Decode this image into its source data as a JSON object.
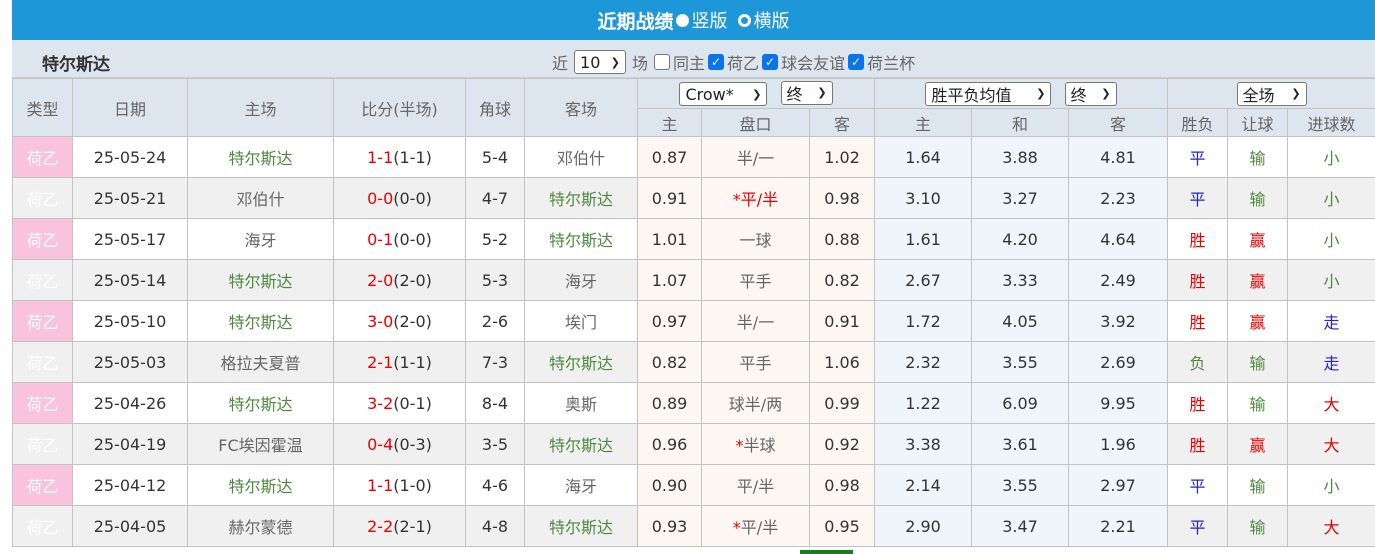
{
  "header": {
    "title": "近期战绩",
    "view_vertical": "竖版",
    "view_horizontal": "横版"
  },
  "filter": {
    "team": "特尔斯达",
    "recent_prefix": "近",
    "count": "10",
    "recent_suffix": "场",
    "same_home": "同主",
    "same_home_checked": false,
    "league": "荷乙",
    "league_checked": true,
    "friendly": "球会友谊",
    "friendly_checked": true,
    "cup": "荷兰杯",
    "cup_checked": true
  },
  "columns": {
    "type": "类型",
    "date": "日期",
    "home": "主场",
    "score": "比分(半场)",
    "corner": "角球",
    "away": "客场",
    "ah_home": "主",
    "ah_line": "盘口",
    "ah_away": "客",
    "eu_home": "主",
    "eu_draw": "和",
    "eu_away": "客",
    "res": "胜负",
    "hcp": "让球",
    "goals": "进球数"
  },
  "selects": {
    "company": "Crow*",
    "ah_time": "终",
    "eu_type": "胜平负均值",
    "eu_time": "终",
    "period": "全场"
  },
  "colors": {
    "header": "#1e97d8",
    "team_highlight": "#4d8a3e",
    "win": "#ee0000",
    "draw": "#2222dd",
    "lose": "#4d8a3e",
    "type_bg": "#f9c3de"
  },
  "rows": [
    {
      "type": "荷乙",
      "date": "25-05-24",
      "home": "特尔斯达",
      "score": "1-1",
      "half": "(1-1)",
      "corner": "5-4",
      "away": "邓伯什",
      "ah_h": "0.87",
      "star": "",
      "line": "半/一",
      "line_red": false,
      "ah_a": "1.02",
      "eu_h": "1.64",
      "eu_d": "3.88",
      "eu_a": "4.81",
      "res": "平",
      "hcp": "输",
      "goals": "小"
    },
    {
      "type": "荷乙",
      "date": "25-05-21",
      "home": "邓伯什",
      "score": "0-0",
      "half": "(0-0)",
      "corner": "4-7",
      "away": "特尔斯达",
      "ah_h": "0.91",
      "star": "*",
      "line": "平/半",
      "line_red": true,
      "ah_a": "0.98",
      "eu_h": "3.10",
      "eu_d": "3.27",
      "eu_a": "2.23",
      "res": "平",
      "hcp": "输",
      "goals": "小"
    },
    {
      "type": "荷乙",
      "date": "25-05-17",
      "home": "海牙",
      "score": "0-1",
      "half": "(0-0)",
      "corner": "5-2",
      "away": "特尔斯达",
      "ah_h": "1.01",
      "star": "",
      "line": "一球",
      "line_red": false,
      "ah_a": "0.88",
      "eu_h": "1.61",
      "eu_d": "4.20",
      "eu_a": "4.64",
      "res": "胜",
      "hcp": "赢",
      "goals": "小"
    },
    {
      "type": "荷乙",
      "date": "25-05-14",
      "home": "特尔斯达",
      "score": "2-0",
      "half": "(2-0)",
      "corner": "5-3",
      "away": "海牙",
      "ah_h": "1.07",
      "star": "",
      "line": "平手",
      "line_red": false,
      "ah_a": "0.82",
      "eu_h": "2.67",
      "eu_d": "3.33",
      "eu_a": "2.49",
      "res": "胜",
      "hcp": "赢",
      "goals": "小"
    },
    {
      "type": "荷乙",
      "date": "25-05-10",
      "home": "特尔斯达",
      "score": "3-0",
      "half": "(2-0)",
      "corner": "2-6",
      "away": "埃门",
      "ah_h": "0.97",
      "star": "",
      "line": "半/一",
      "line_red": false,
      "ah_a": "0.91",
      "eu_h": "1.72",
      "eu_d": "4.05",
      "eu_a": "3.92",
      "res": "胜",
      "hcp": "赢",
      "goals": "走"
    },
    {
      "type": "荷乙",
      "date": "25-05-03",
      "home": "格拉夫夏普",
      "score": "2-1",
      "half": "(1-1)",
      "corner": "7-3",
      "away": "特尔斯达",
      "ah_h": "0.82",
      "star": "",
      "line": "平手",
      "line_red": false,
      "ah_a": "1.06",
      "eu_h": "2.32",
      "eu_d": "3.55",
      "eu_a": "2.69",
      "res": "负",
      "hcp": "输",
      "goals": "走"
    },
    {
      "type": "荷乙",
      "date": "25-04-26",
      "home": "特尔斯达",
      "score": "3-2",
      "half": "(0-1)",
      "corner": "8-4",
      "away": "奥斯",
      "ah_h": "0.89",
      "star": "",
      "line": "球半/两",
      "line_red": false,
      "ah_a": "0.99",
      "eu_h": "1.22",
      "eu_d": "6.09",
      "eu_a": "9.95",
      "res": "胜",
      "hcp": "输",
      "goals": "大"
    },
    {
      "type": "荷乙",
      "date": "25-04-19",
      "home": "FC埃因霍温",
      "score": "0-4",
      "half": "(0-3)",
      "corner": "3-5",
      "away": "特尔斯达",
      "ah_h": "0.96",
      "star": "*",
      "line": "半球",
      "line_red": false,
      "ah_a": "0.92",
      "eu_h": "3.38",
      "eu_d": "3.61",
      "eu_a": "1.96",
      "res": "胜",
      "hcp": "赢",
      "goals": "大"
    },
    {
      "type": "荷乙",
      "date": "25-04-12",
      "home": "特尔斯达",
      "score": "1-1",
      "half": "(1-0)",
      "corner": "4-6",
      "away": "海牙",
      "ah_h": "0.90",
      "star": "",
      "line": "平/半",
      "line_red": false,
      "ah_a": "0.98",
      "eu_h": "2.14",
      "eu_d": "3.55",
      "eu_a": "2.97",
      "res": "平",
      "hcp": "输",
      "goals": "小"
    },
    {
      "type": "荷乙",
      "date": "25-04-05",
      "home": "赫尔蒙德",
      "score": "2-2",
      "half": "(2-1)",
      "corner": "4-8",
      "away": "特尔斯达",
      "ah_h": "0.93",
      "star": "*",
      "line": "平/半",
      "line_red": false,
      "ah_a": "0.95",
      "eu_h": "2.90",
      "eu_d": "3.47",
      "eu_a": "2.21",
      "res": "平",
      "hcp": "输",
      "goals": "大"
    }
  ]
}
